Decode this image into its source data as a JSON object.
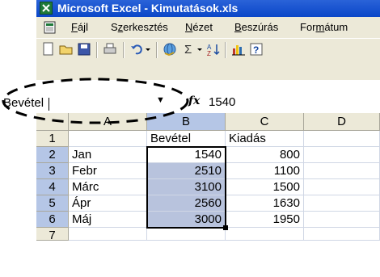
{
  "window": {
    "title": "Microsoft Excel - Kimutatások.xls"
  },
  "menu": [
    "Fájl",
    "Szerkesztés",
    "Nézet",
    "Beszúrás",
    "Formátum"
  ],
  "menu_underline": [
    "F",
    "z",
    "N",
    "B",
    "m"
  ],
  "formula_bar": {
    "name_box": "Bevétel",
    "fx": "fx",
    "value": "1540"
  },
  "columns": [
    "A",
    "B",
    "C",
    "D"
  ],
  "rows": [
    {
      "num": "1",
      "a": "",
      "b": "Bevétel",
      "c": "Kiadás"
    },
    {
      "num": "2",
      "a": "Jan",
      "b": "1540",
      "c": "800"
    },
    {
      "num": "3",
      "a": "Febr",
      "b": "2510",
      "c": "1100"
    },
    {
      "num": "4",
      "a": "Márc",
      "b": "3100",
      "c": "1500"
    },
    {
      "num": "5",
      "a": "Ápr",
      "b": "2560",
      "c": "1630"
    },
    {
      "num": "6",
      "a": "Máj",
      "b": "3000",
      "c": "1950"
    },
    {
      "num": "7",
      "a": "",
      "b": "",
      "c": ""
    }
  ],
  "colors": {
    "titlebar": "#0a46c8",
    "selection": "#b8c3dd",
    "chrome": "#ece9d8"
  }
}
